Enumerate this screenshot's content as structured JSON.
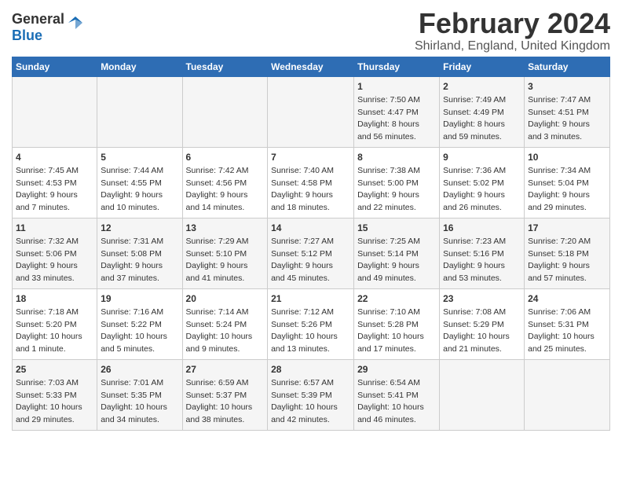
{
  "header": {
    "logo_general": "General",
    "logo_blue": "Blue",
    "month": "February 2024",
    "location": "Shirland, England, United Kingdom"
  },
  "columns": [
    "Sunday",
    "Monday",
    "Tuesday",
    "Wednesday",
    "Thursday",
    "Friday",
    "Saturday"
  ],
  "rows": [
    [
      {
        "day": "",
        "info": ""
      },
      {
        "day": "",
        "info": ""
      },
      {
        "day": "",
        "info": ""
      },
      {
        "day": "",
        "info": ""
      },
      {
        "day": "1",
        "info": "Sunrise: 7:50 AM\nSunset: 4:47 PM\nDaylight: 8 hours\nand 56 minutes."
      },
      {
        "day": "2",
        "info": "Sunrise: 7:49 AM\nSunset: 4:49 PM\nDaylight: 8 hours\nand 59 minutes."
      },
      {
        "day": "3",
        "info": "Sunrise: 7:47 AM\nSunset: 4:51 PM\nDaylight: 9 hours\nand 3 minutes."
      }
    ],
    [
      {
        "day": "4",
        "info": "Sunrise: 7:45 AM\nSunset: 4:53 PM\nDaylight: 9 hours\nand 7 minutes."
      },
      {
        "day": "5",
        "info": "Sunrise: 7:44 AM\nSunset: 4:55 PM\nDaylight: 9 hours\nand 10 minutes."
      },
      {
        "day": "6",
        "info": "Sunrise: 7:42 AM\nSunset: 4:56 PM\nDaylight: 9 hours\nand 14 minutes."
      },
      {
        "day": "7",
        "info": "Sunrise: 7:40 AM\nSunset: 4:58 PM\nDaylight: 9 hours\nand 18 minutes."
      },
      {
        "day": "8",
        "info": "Sunrise: 7:38 AM\nSunset: 5:00 PM\nDaylight: 9 hours\nand 22 minutes."
      },
      {
        "day": "9",
        "info": "Sunrise: 7:36 AM\nSunset: 5:02 PM\nDaylight: 9 hours\nand 26 minutes."
      },
      {
        "day": "10",
        "info": "Sunrise: 7:34 AM\nSunset: 5:04 PM\nDaylight: 9 hours\nand 29 minutes."
      }
    ],
    [
      {
        "day": "11",
        "info": "Sunrise: 7:32 AM\nSunset: 5:06 PM\nDaylight: 9 hours\nand 33 minutes."
      },
      {
        "day": "12",
        "info": "Sunrise: 7:31 AM\nSunset: 5:08 PM\nDaylight: 9 hours\nand 37 minutes."
      },
      {
        "day": "13",
        "info": "Sunrise: 7:29 AM\nSunset: 5:10 PM\nDaylight: 9 hours\nand 41 minutes."
      },
      {
        "day": "14",
        "info": "Sunrise: 7:27 AM\nSunset: 5:12 PM\nDaylight: 9 hours\nand 45 minutes."
      },
      {
        "day": "15",
        "info": "Sunrise: 7:25 AM\nSunset: 5:14 PM\nDaylight: 9 hours\nand 49 minutes."
      },
      {
        "day": "16",
        "info": "Sunrise: 7:23 AM\nSunset: 5:16 PM\nDaylight: 9 hours\nand 53 minutes."
      },
      {
        "day": "17",
        "info": "Sunrise: 7:20 AM\nSunset: 5:18 PM\nDaylight: 9 hours\nand 57 minutes."
      }
    ],
    [
      {
        "day": "18",
        "info": "Sunrise: 7:18 AM\nSunset: 5:20 PM\nDaylight: 10 hours\nand 1 minute."
      },
      {
        "day": "19",
        "info": "Sunrise: 7:16 AM\nSunset: 5:22 PM\nDaylight: 10 hours\nand 5 minutes."
      },
      {
        "day": "20",
        "info": "Sunrise: 7:14 AM\nSunset: 5:24 PM\nDaylight: 10 hours\nand 9 minutes."
      },
      {
        "day": "21",
        "info": "Sunrise: 7:12 AM\nSunset: 5:26 PM\nDaylight: 10 hours\nand 13 minutes."
      },
      {
        "day": "22",
        "info": "Sunrise: 7:10 AM\nSunset: 5:28 PM\nDaylight: 10 hours\nand 17 minutes."
      },
      {
        "day": "23",
        "info": "Sunrise: 7:08 AM\nSunset: 5:29 PM\nDaylight: 10 hours\nand 21 minutes."
      },
      {
        "day": "24",
        "info": "Sunrise: 7:06 AM\nSunset: 5:31 PM\nDaylight: 10 hours\nand 25 minutes."
      }
    ],
    [
      {
        "day": "25",
        "info": "Sunrise: 7:03 AM\nSunset: 5:33 PM\nDaylight: 10 hours\nand 29 minutes."
      },
      {
        "day": "26",
        "info": "Sunrise: 7:01 AM\nSunset: 5:35 PM\nDaylight: 10 hours\nand 34 minutes."
      },
      {
        "day": "27",
        "info": "Sunrise: 6:59 AM\nSunset: 5:37 PM\nDaylight: 10 hours\nand 38 minutes."
      },
      {
        "day": "28",
        "info": "Sunrise: 6:57 AM\nSunset: 5:39 PM\nDaylight: 10 hours\nand 42 minutes."
      },
      {
        "day": "29",
        "info": "Sunrise: 6:54 AM\nSunset: 5:41 PM\nDaylight: 10 hours\nand 46 minutes."
      },
      {
        "day": "",
        "info": ""
      },
      {
        "day": "",
        "info": ""
      }
    ]
  ]
}
